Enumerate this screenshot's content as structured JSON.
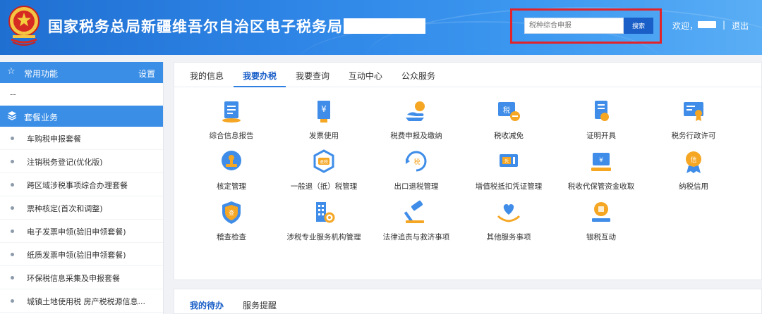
{
  "header": {
    "title": "国家税务总局新疆维吾尔自治区电子税务局",
    "search_placeholder": "税种综合申报",
    "search_button": "搜索",
    "welcome": "欢迎，",
    "separator": "|",
    "logout": "退出"
  },
  "sidebar": {
    "common_title": "常用功能",
    "settings": "设置",
    "common_placeholder": "--",
    "package_title": "套餐业务",
    "items": [
      {
        "label": "车购税申报套餐"
      },
      {
        "label": "注销税务登记(优化版)"
      },
      {
        "label": "跨区域涉税事项综合办理套餐"
      },
      {
        "label": "票种核定(首次和调整)"
      },
      {
        "label": "电子发票申领(验旧申领套餐)"
      },
      {
        "label": "纸质发票申领(验旧申领套餐)"
      },
      {
        "label": "环保税信息采集及申报套餐"
      },
      {
        "label": "城镇土地使用税 房产税税源信息..."
      }
    ]
  },
  "main": {
    "tabs": [
      {
        "label": "我的信息"
      },
      {
        "label": "我要办税"
      },
      {
        "label": "我要查询"
      },
      {
        "label": "互动中心"
      },
      {
        "label": "公众服务"
      }
    ],
    "active_tab": "我要办税",
    "tiles": [
      {
        "label": "综合信息报告",
        "icon": "document-report-icon"
      },
      {
        "label": "发票使用",
        "icon": "invoice-yuan-icon"
      },
      {
        "label": "税费申报及缴纳",
        "icon": "hand-coin-icon"
      },
      {
        "label": "税收减免",
        "icon": "tax-reduction-icon"
      },
      {
        "label": "证明开具",
        "icon": "certificate-icon"
      },
      {
        "label": "税务行政许可",
        "icon": "license-screen-icon"
      },
      {
        "label": "核定管理",
        "icon": "stamp-icon"
      },
      {
        "label": "一般退（抵）税管理",
        "icon": "refund-hexagon-icon"
      },
      {
        "label": "出口退税管理",
        "icon": "export-refund-icon"
      },
      {
        "label": "增值税抵扣凭证管理",
        "icon": "voucher-ticket-icon"
      },
      {
        "label": "税收代保管资金收取",
        "icon": "funds-custody-icon"
      },
      {
        "label": "纳税信用",
        "icon": "credit-medal-icon"
      },
      {
        "label": "稽查检查",
        "icon": "inspection-shield-icon"
      },
      {
        "label": "涉税专业服务机构管理",
        "icon": "building-gear-icon"
      },
      {
        "label": "法律追责与救济事项",
        "icon": "gavel-icon"
      },
      {
        "label": "其他服务事项",
        "icon": "heart-hands-icon"
      },
      {
        "label": "银税互动",
        "icon": "bank-coin-icon"
      }
    ]
  },
  "bottom": {
    "tabs": [
      {
        "label": "我的待办"
      },
      {
        "label": "服务提醒"
      }
    ]
  },
  "colors": {
    "primary": "#2f86e6",
    "accent_blue": "#1a5fc8",
    "icon_orange": "#f5a623",
    "highlight_red": "#e2232a"
  }
}
